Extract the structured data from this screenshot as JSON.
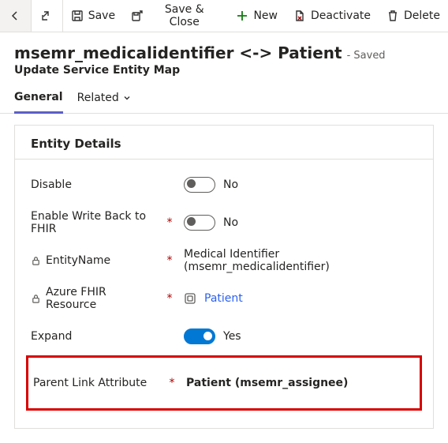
{
  "toolbar": {
    "save": "Save",
    "save_close": "Save & Close",
    "new": "New",
    "deactivate": "Deactivate",
    "delete": "Delete"
  },
  "header": {
    "title": "msemr_medicalidentifier <-> Patient",
    "status_suffix": "- Saved",
    "subtitle": "Update Service Entity Map"
  },
  "tabs": {
    "general": "General",
    "related": "Related"
  },
  "card": {
    "title": "Entity Details"
  },
  "fields": {
    "disable": {
      "label": "Disable",
      "value": "No"
    },
    "write_back": {
      "label": "Enable Write Back to FHIR",
      "value": "No"
    },
    "entity_name": {
      "label": "EntityName",
      "value": "Medical Identifier (msemr_medicalidentifier)"
    },
    "fhir_resource": {
      "label": "Azure FHIR Resource",
      "value": "Patient"
    },
    "expand": {
      "label": "Expand",
      "value": "Yes"
    },
    "parent_link": {
      "label": "Parent Link Attribute",
      "value": "Patient (msemr_assignee)"
    }
  }
}
